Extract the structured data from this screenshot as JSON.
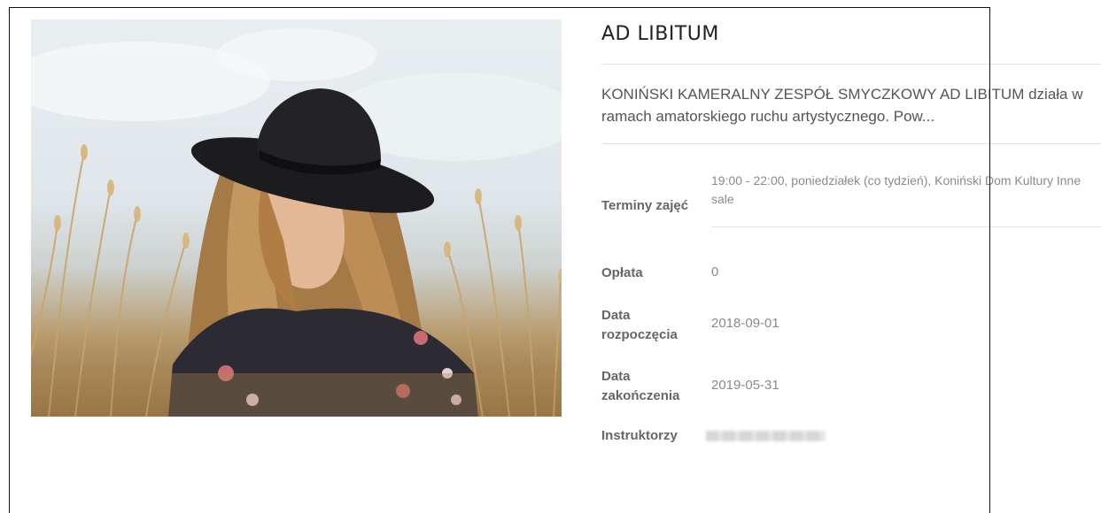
{
  "course": {
    "title": "AD LIBITUM",
    "description": "KONIŃSKI KAMERALNY ZESPÓŁ SMYCZKOWY AD LIBITUM działa w ramach amatorskiego ruchu artystycznego. Pow..."
  },
  "details": {
    "schedule_label": "Terminy zajęć",
    "schedule_value": "19:00 - 22:00, poniedziałek  (co tydzień), Koniński Dom Kultury Inne sale",
    "fee_label": "Opłata",
    "fee_value": "0",
    "start_label_line1": "Data",
    "start_label_line2": "rozpoczęcia",
    "start_value": "2018-09-01",
    "end_label_line1": "Data",
    "end_label_line2": "zakończenia",
    "end_value": "2019-05-31",
    "instructors_label": "Instruktorzy"
  },
  "photo": {
    "subject": "woman-in-black-hat-among-dry-grass"
  }
}
